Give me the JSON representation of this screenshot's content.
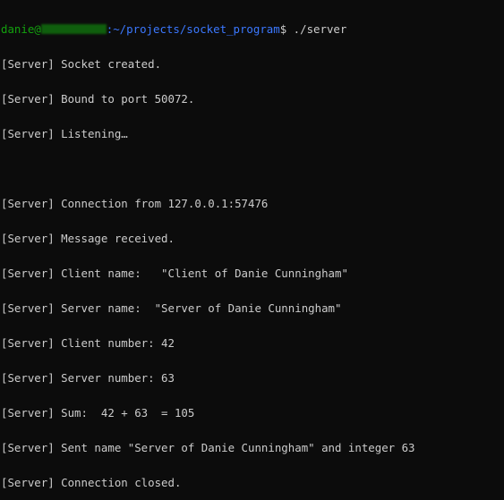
{
  "prompt": {
    "user": "danie@",
    "path": ":~/projects/socket_program",
    "symbol": "$",
    "command": " ./server"
  },
  "output": [
    "[Server] Socket created.",
    "[Server] Bound to port 50072.",
    "[Server] Listening…",
    "",
    "[Server] Connection from 127.0.0.1:57476",
    "[Server] Message received.",
    "[Server] Client name:   \"Client of Danie Cunningham\"",
    "[Server] Server name:  \"Server of Danie Cunningham\"",
    "[Server] Client number: 42",
    "[Server] Server number: 63",
    "[Server] Sum:  42 + 63  = 105",
    "[Server] Sent name \"Server of Danie Cunningham\" and integer 63",
    "[Server] Connection closed."
  ]
}
